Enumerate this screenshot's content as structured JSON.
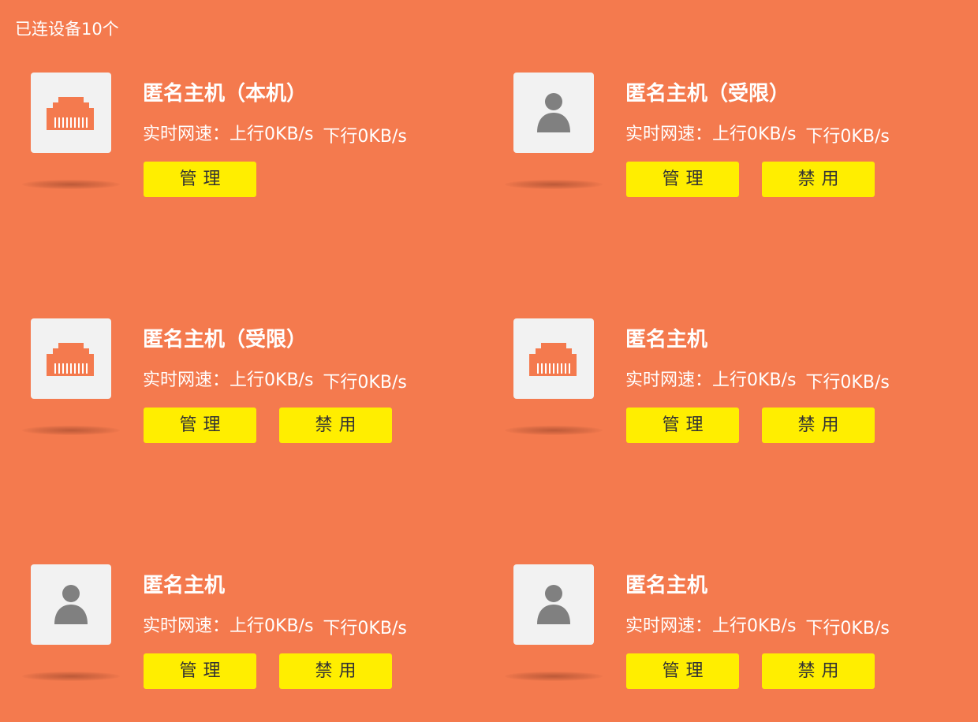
{
  "header": {
    "connected_count": "已连设备10个"
  },
  "devices": [
    {
      "name": "匿名主机（本机）",
      "icon": "ethernet-icon",
      "speed_label": "实时网速：",
      "upload": "上行0KB/s",
      "download": "下行0KB/s",
      "manage_label": "管理",
      "disable_label": ""
    },
    {
      "name": "匿名主机（受限）",
      "icon": "user-icon",
      "speed_label": "实时网速：",
      "upload": "上行0KB/s",
      "download": "下行0KB/s",
      "manage_label": "管理",
      "disable_label": "禁用"
    },
    {
      "name": "匿名主机（受限）",
      "icon": "ethernet-icon",
      "speed_label": "实时网速：",
      "upload": "上行0KB/s",
      "download": "下行0KB/s",
      "manage_label": "管理",
      "disable_label": "禁用"
    },
    {
      "name": "匿名主机",
      "icon": "ethernet-icon",
      "speed_label": "实时网速：",
      "upload": "上行0KB/s",
      "download": "下行0KB/s",
      "manage_label": "管理",
      "disable_label": "禁用"
    },
    {
      "name": "匿名主机",
      "icon": "user-icon",
      "speed_label": "实时网速：",
      "upload": "上行0KB/s",
      "download": "下行0KB/s",
      "manage_label": "管理",
      "disable_label": "禁用"
    },
    {
      "name": "匿名主机",
      "icon": "user-icon",
      "speed_label": "实时网速：",
      "upload": "上行0KB/s",
      "download": "下行0KB/s",
      "manage_label": "管理",
      "disable_label": "禁用"
    }
  ],
  "colors": {
    "background": "#f47a4e",
    "button": "#ffee00",
    "icon_box": "#f2f2f2",
    "ethernet_icon": "#f47a4e",
    "user_icon": "#808080"
  }
}
